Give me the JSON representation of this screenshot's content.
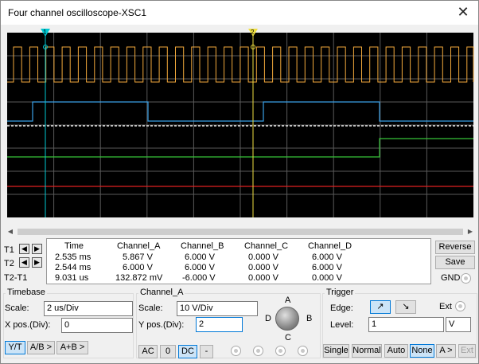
{
  "window": {
    "title": "Four channel oscilloscope-XSC1",
    "close_glyph": "✕"
  },
  "scope": {
    "background": "#000000",
    "grid_color": "#5a5a5a",
    "cursor1_label": "1",
    "cursor2_label": "2",
    "cursor1_color": "#00c8d2",
    "cursor2_color": "#f0e040",
    "channel_colors": {
      "A": "#f2a93b",
      "B": "#3aa0e6",
      "C": "#ffffff",
      "D": "#36c238",
      "E": "#e02020"
    }
  },
  "cursors": {
    "t1_label": "T1",
    "t2_label": "T2",
    "t2t1_label": "T2-T1",
    "left_arrow": "◀",
    "right_arrow": "▶"
  },
  "readout": {
    "headers": [
      "Time",
      "Channel_A",
      "Channel_B",
      "Channel_C",
      "Channel_D"
    ],
    "rows": [
      [
        "2.535 ms",
        "5.867 V",
        "6.000 V",
        "0.000 V",
        "6.000 V"
      ],
      [
        "2.544 ms",
        "6.000 V",
        "6.000 V",
        "0.000 V",
        "6.000 V"
      ],
      [
        "9.031 us",
        "132.872 mV",
        "-6.000 V",
        "0.000 V",
        "0.000 V"
      ]
    ]
  },
  "side_buttons": {
    "reverse": "Reverse",
    "save": "Save",
    "gnd": "GND"
  },
  "timebase": {
    "title": "Timebase",
    "scale_label": "Scale:",
    "scale_value": "2 us/Div",
    "xpos_label": "X pos.(Div):",
    "xpos_value": "0",
    "buttons": [
      "Y/T",
      "A/B >",
      "A+B >"
    ],
    "selected": "Y/T"
  },
  "channel": {
    "title": "Channel_A",
    "scale_label": "Scale:",
    "scale_value": "10  V/Div",
    "ypos_label": "Y pos.(Div):",
    "ypos_value": "2",
    "coupling": [
      "AC",
      "0",
      "DC",
      "-"
    ],
    "selected": "DC",
    "knob_labels": {
      "A": "A",
      "B": "B",
      "C": "C",
      "D": "D"
    }
  },
  "trigger": {
    "title": "Trigger",
    "edge_label": "Edge:",
    "rising_glyph": "↗",
    "falling_glyph": "↘",
    "ext_label": "Ext",
    "level_label": "Level:",
    "level_value": "1",
    "level_unit": "V",
    "modes": [
      "Single",
      "Normal",
      "Auto",
      "None",
      "A >",
      "Ext"
    ],
    "selected": "None"
  }
}
